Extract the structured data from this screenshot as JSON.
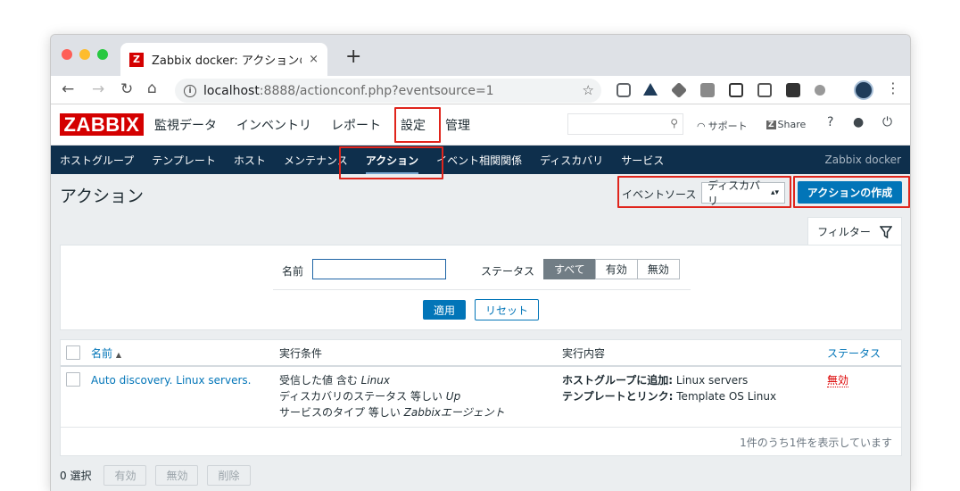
{
  "browser": {
    "tab_icon": "Z",
    "tab_title": "Zabbix docker: アクションの設定",
    "tab_close": "×",
    "new_tab": "+",
    "url_host": "localhost",
    "url_path": ":8888/actionconf.php?eventsource=1"
  },
  "header": {
    "logo": "ZABBIX",
    "menu": [
      "監視データ",
      "インベントリ",
      "レポート",
      "設定",
      "管理"
    ],
    "support": "サポート",
    "share_badge": "Z",
    "share": "Share",
    "help": "?"
  },
  "submenu": {
    "items": [
      "ホストグループ",
      "テンプレート",
      "ホスト",
      "メンテナンス",
      "アクション",
      "イベント相関関係",
      "ディスカバリ",
      "サービス"
    ],
    "active_index": 4,
    "server_name": "Zabbix docker"
  },
  "page": {
    "title": "アクション",
    "event_source_label": "イベントソース",
    "event_source_value": "ディスカバリ",
    "create_button": "アクションの作成"
  },
  "filter": {
    "tab_label": "フィルター",
    "name_label": "名前",
    "name_value": "",
    "status_label": "ステータス",
    "status_options": [
      "すべて",
      "有効",
      "無効"
    ],
    "status_selected": 0,
    "apply": "適用",
    "reset": "リセット"
  },
  "table": {
    "headers": {
      "name": "名前",
      "sort_indicator": "▲",
      "conditions": "実行条件",
      "operations": "実行内容",
      "status": "ステータス"
    },
    "rows": [
      {
        "name": "Auto discovery. Linux servers.",
        "conditions": [
          {
            "text": "受信した値 含む ",
            "value": "Linux"
          },
          {
            "text": "ディスカバリのステータス 等しい ",
            "value": "Up"
          },
          {
            "text": "サービスのタイプ 等しい ",
            "value": "Zabbixエージェント"
          }
        ],
        "operations": [
          {
            "label": "ホストグループに追加:",
            "value": " Linux servers"
          },
          {
            "label": "テンプレートとリンク:",
            "value": " Template OS Linux"
          }
        ],
        "status": "無効"
      }
    ],
    "footer": "1件のうち1件を表示しています"
  },
  "mass": {
    "selected": "0 選択",
    "buttons": [
      "有効",
      "無効",
      "削除"
    ]
  }
}
